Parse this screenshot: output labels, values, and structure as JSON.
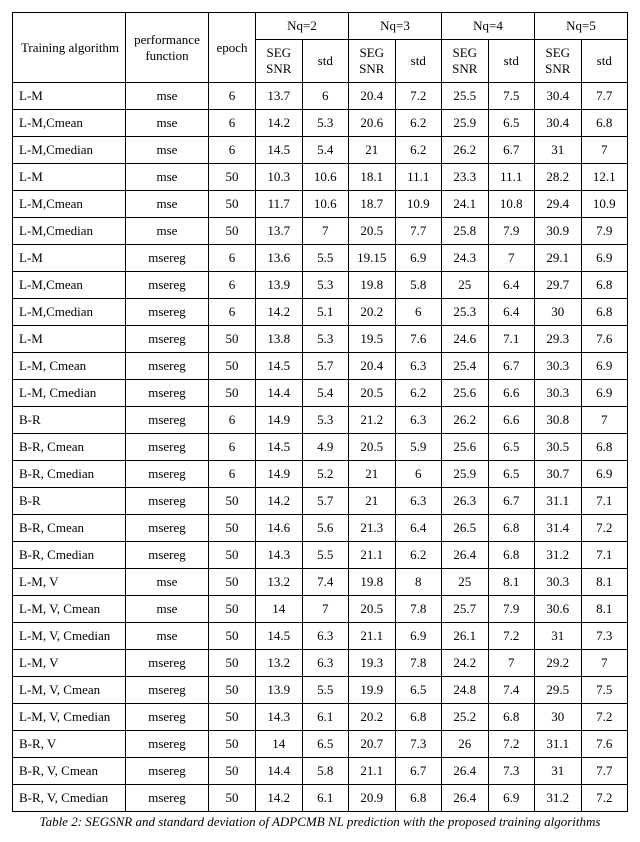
{
  "headers": {
    "alg": "Training algorithm",
    "perf": "performance function",
    "epoch": "epoch",
    "nq2": "Nq=2",
    "nq3": "Nq=3",
    "nq4": "Nq=4",
    "nq5": "Nq=5",
    "seg": "SEG SNR",
    "std": "std"
  },
  "caption": "Table 2: SEGSNR and standard deviation of ADPCMB NL prediction with the proposed training algorithms",
  "rows": [
    {
      "alg": "L-M",
      "perf": "mse",
      "epoch": "6",
      "s2": "13.7",
      "d2": "6",
      "s3": "20.4",
      "d3": "7.2",
      "s4": "25.5",
      "d4": "7.5",
      "s5": "30.4",
      "d5": "7.7"
    },
    {
      "alg": "L-M,Cmean",
      "perf": "mse",
      "epoch": "6",
      "s2": "14.2",
      "d2": "5.3",
      "s3": "20.6",
      "d3": "6.2",
      "s4": "25.9",
      "d4": "6.5",
      "s5": "30.4",
      "d5": "6.8"
    },
    {
      "alg": "L-M,Cmedian",
      "perf": "mse",
      "epoch": "6",
      "s2": "14.5",
      "d2": "5.4",
      "s3": "21",
      "d3": "6.2",
      "s4": "26.2",
      "d4": "6.7",
      "s5": "31",
      "d5": "7"
    },
    {
      "alg": "L-M",
      "perf": "mse",
      "epoch": "50",
      "s2": "10.3",
      "d2": "10.6",
      "s3": "18.1",
      "d3": "11.1",
      "s4": "23.3",
      "d4": "11.1",
      "s5": "28.2",
      "d5": "12.1"
    },
    {
      "alg": "L-M,Cmean",
      "perf": "mse",
      "epoch": "50",
      "s2": "11.7",
      "d2": "10.6",
      "s3": "18.7",
      "d3": "10.9",
      "s4": "24.1",
      "d4": "10.8",
      "s5": "29.4",
      "d5": "10.9"
    },
    {
      "alg": "L-M,Cmedian",
      "perf": "mse",
      "epoch": "50",
      "s2": "13.7",
      "d2": "7",
      "s3": "20.5",
      "d3": "7.7",
      "s4": "25.8",
      "d4": "7.9",
      "s5": "30.9",
      "d5": "7.9"
    },
    {
      "alg": "L-M",
      "perf": "msereg",
      "epoch": "6",
      "s2": "13.6",
      "d2": "5.5",
      "s3": "19.15",
      "d3": "6.9",
      "s4": "24.3",
      "d4": "7",
      "s5": "29.1",
      "d5": "6.9"
    },
    {
      "alg": "L-M,Cmean",
      "perf": "msereg",
      "epoch": "6",
      "s2": "13.9",
      "d2": "5.3",
      "s3": "19.8",
      "d3": "5.8",
      "s4": "25",
      "d4": "6.4",
      "s5": "29.7",
      "d5": "6.8"
    },
    {
      "alg": "L-M,Cmedian",
      "perf": "msereg",
      "epoch": "6",
      "s2": "14.2",
      "d2": "5.1",
      "s3": "20.2",
      "d3": "6",
      "s4": "25.3",
      "d4": "6.4",
      "s5": "30",
      "d5": "6.8"
    },
    {
      "alg": "L-M",
      "perf": "msereg",
      "epoch": "50",
      "s2": "13.8",
      "d2": "5.3",
      "s3": "19.5",
      "d3": "7.6",
      "s4": "24.6",
      "d4": "7.1",
      "s5": "29.3",
      "d5": "7.6"
    },
    {
      "alg": "L-M, Cmean",
      "perf": "msereg",
      "epoch": "50",
      "s2": "14.5",
      "d2": "5.7",
      "s3": "20.4",
      "d3": "6.3",
      "s4": "25.4",
      "d4": "6.7",
      "s5": "30.3",
      "d5": "6.9"
    },
    {
      "alg": "L-M, Cmedian",
      "perf": "msereg",
      "epoch": "50",
      "s2": "14.4",
      "d2": "5.4",
      "s3": "20.5",
      "d3": "6.2",
      "s4": "25.6",
      "d4": "6.6",
      "s5": "30.3",
      "d5": "6.9"
    },
    {
      "alg": "B-R",
      "perf": "msereg",
      "epoch": "6",
      "s2": "14.9",
      "d2": "5.3",
      "s3": "21.2",
      "d3": "6.3",
      "s4": "26.2",
      "d4": "6.6",
      "s5": "30.8",
      "d5": "7"
    },
    {
      "alg": "B-R, Cmean",
      "perf": "msereg",
      "epoch": "6",
      "s2": "14.5",
      "d2": "4.9",
      "s3": "20.5",
      "d3": "5.9",
      "s4": "25.6",
      "d4": "6.5",
      "s5": "30.5",
      "d5": "6.8"
    },
    {
      "alg": "B-R, Cmedian",
      "perf": "msereg",
      "epoch": "6",
      "s2": "14.9",
      "d2": "5.2",
      "s3": "21",
      "d3": "6",
      "s4": "25.9",
      "d4": "6.5",
      "s5": "30.7",
      "d5": "6.9"
    },
    {
      "alg": "B-R",
      "perf": "msereg",
      "epoch": "50",
      "s2": "14.2",
      "d2": "5.7",
      "s3": "21",
      "d3": "6.3",
      "s4": "26.3",
      "d4": "6.7",
      "s5": "31.1",
      "d5": "7.1"
    },
    {
      "alg": "B-R, Cmean",
      "perf": "msereg",
      "epoch": "50",
      "s2": "14.6",
      "d2": "5.6",
      "s3": "21.3",
      "d3": "6.4",
      "s4": "26.5",
      "d4": "6.8",
      "s5": "31.4",
      "d5": "7.2"
    },
    {
      "alg": "B-R, Cmedian",
      "perf": "msereg",
      "epoch": "50",
      "s2": "14.3",
      "d2": "5.5",
      "s3": "21.1",
      "d3": "6.2",
      "s4": "26.4",
      "d4": "6.8",
      "s5": "31.2",
      "d5": "7.1"
    },
    {
      "alg": "L-M, V",
      "perf": "mse",
      "epoch": "50",
      "s2": "13.2",
      "d2": "7.4",
      "s3": "19.8",
      "d3": "8",
      "s4": "25",
      "d4": "8.1",
      "s5": "30.3",
      "d5": "8.1"
    },
    {
      "alg": "L-M, V, Cmean",
      "perf": "mse",
      "epoch": "50",
      "s2": "14",
      "d2": "7",
      "s3": "20.5",
      "d3": "7.8",
      "s4": "25.7",
      "d4": "7.9",
      "s5": "30.6",
      "d5": "8.1"
    },
    {
      "alg": "L-M, V, Cmedian",
      "perf": "mse",
      "epoch": "50",
      "s2": "14.5",
      "d2": "6.3",
      "s3": "21.1",
      "d3": "6.9",
      "s4": "26.1",
      "d4": "7.2",
      "s5": "31",
      "d5": "7.3"
    },
    {
      "alg": "L-M, V",
      "perf": "msereg",
      "epoch": "50",
      "s2": "13.2",
      "d2": "6.3",
      "s3": "19.3",
      "d3": "7.8",
      "s4": "24.2",
      "d4": "7",
      "s5": "29.2",
      "d5": "7"
    },
    {
      "alg": "L-M, V, Cmean",
      "perf": "msereg",
      "epoch": "50",
      "s2": "13.9",
      "d2": "5.5",
      "s3": "19.9",
      "d3": "6.5",
      "s4": "24.8",
      "d4": "7.4",
      "s5": "29.5",
      "d5": "7.5"
    },
    {
      "alg": "L-M, V, Cmedian",
      "perf": "msereg",
      "epoch": "50",
      "s2": "14.3",
      "d2": "6.1",
      "s3": "20.2",
      "d3": "6.8",
      "s4": "25.2",
      "d4": "6.8",
      "s5": "30",
      "d5": "7.2"
    },
    {
      "alg": "B-R, V",
      "perf": "msereg",
      "epoch": "50",
      "s2": "14",
      "d2": "6.5",
      "s3": "20.7",
      "d3": "7.3",
      "s4": "26",
      "d4": "7.2",
      "s5": "31.1",
      "d5": "7.6"
    },
    {
      "alg": "B-R, V, Cmean",
      "perf": "msereg",
      "epoch": "50",
      "s2": "14.4",
      "d2": "5.8",
      "s3": "21.1",
      "d3": "6.7",
      "s4": "26.4",
      "d4": "7.3",
      "s5": "31",
      "d5": "7.7"
    },
    {
      "alg": "B-R, V, Cmedian",
      "perf": "msereg",
      "epoch": "50",
      "s2": "14.2",
      "d2": "6.1",
      "s3": "20.9",
      "d3": "6.8",
      "s4": "26.4",
      "d4": "6.9",
      "s5": "31.2",
      "d5": "7.2"
    }
  ]
}
